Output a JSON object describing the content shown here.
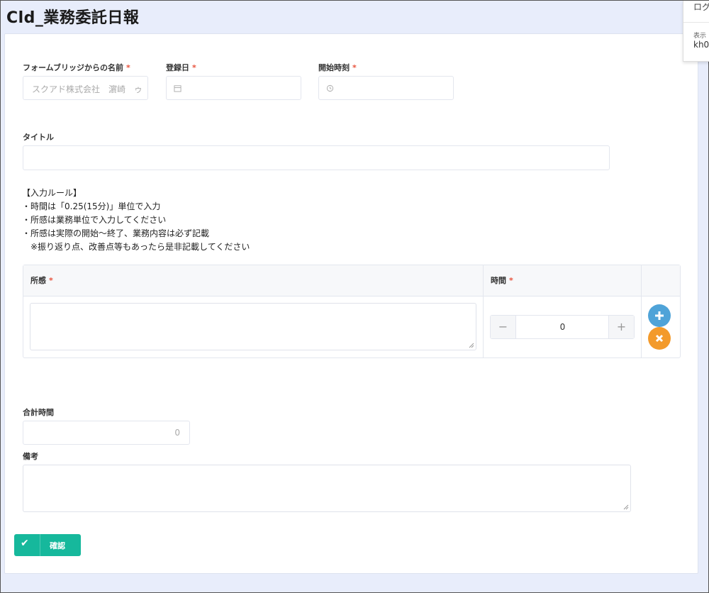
{
  "page": {
    "title": "Cld_業務委託日報"
  },
  "user_popup": {
    "login_label": "ログ",
    "display_label": "表示",
    "user_id": "kh0"
  },
  "form": {
    "name_field": {
      "label": "フォームブリッジからの名前",
      "required": "*",
      "value": "スクアド株式会社　濵崎　ゥ"
    },
    "reg_date": {
      "label": "登録日",
      "required": "*"
    },
    "start_time": {
      "label": "開始時刻",
      "required": "*"
    },
    "title_field": {
      "label": "タイトル",
      "value": ""
    },
    "rules": "【入力ルール】\n・時間は「0.25(15分)」単位で入力\n・所感は業務単位で入力してください\n・所感は実際の開始～終了、業務内容は必ず記載\n　※振り返り点、改善点等もあったら是非記載してください",
    "table": {
      "col_impression": "所感",
      "col_time": "時間",
      "required": "*",
      "rows": [
        {
          "impression": "",
          "time": "0"
        }
      ],
      "minus": "−",
      "plus": "+",
      "add_icon": "plus-icon",
      "remove_icon": "close-icon"
    },
    "total_time": {
      "label": "合計時間",
      "value": "0"
    },
    "remarks": {
      "label": "備考",
      "value": ""
    },
    "confirm_button": {
      "label": "確認",
      "icon": "check-icon"
    }
  },
  "colors": {
    "accent": "#16b89c",
    "add": "#4fa3d8",
    "remove": "#f39a2b",
    "required": "#e8523c"
  }
}
